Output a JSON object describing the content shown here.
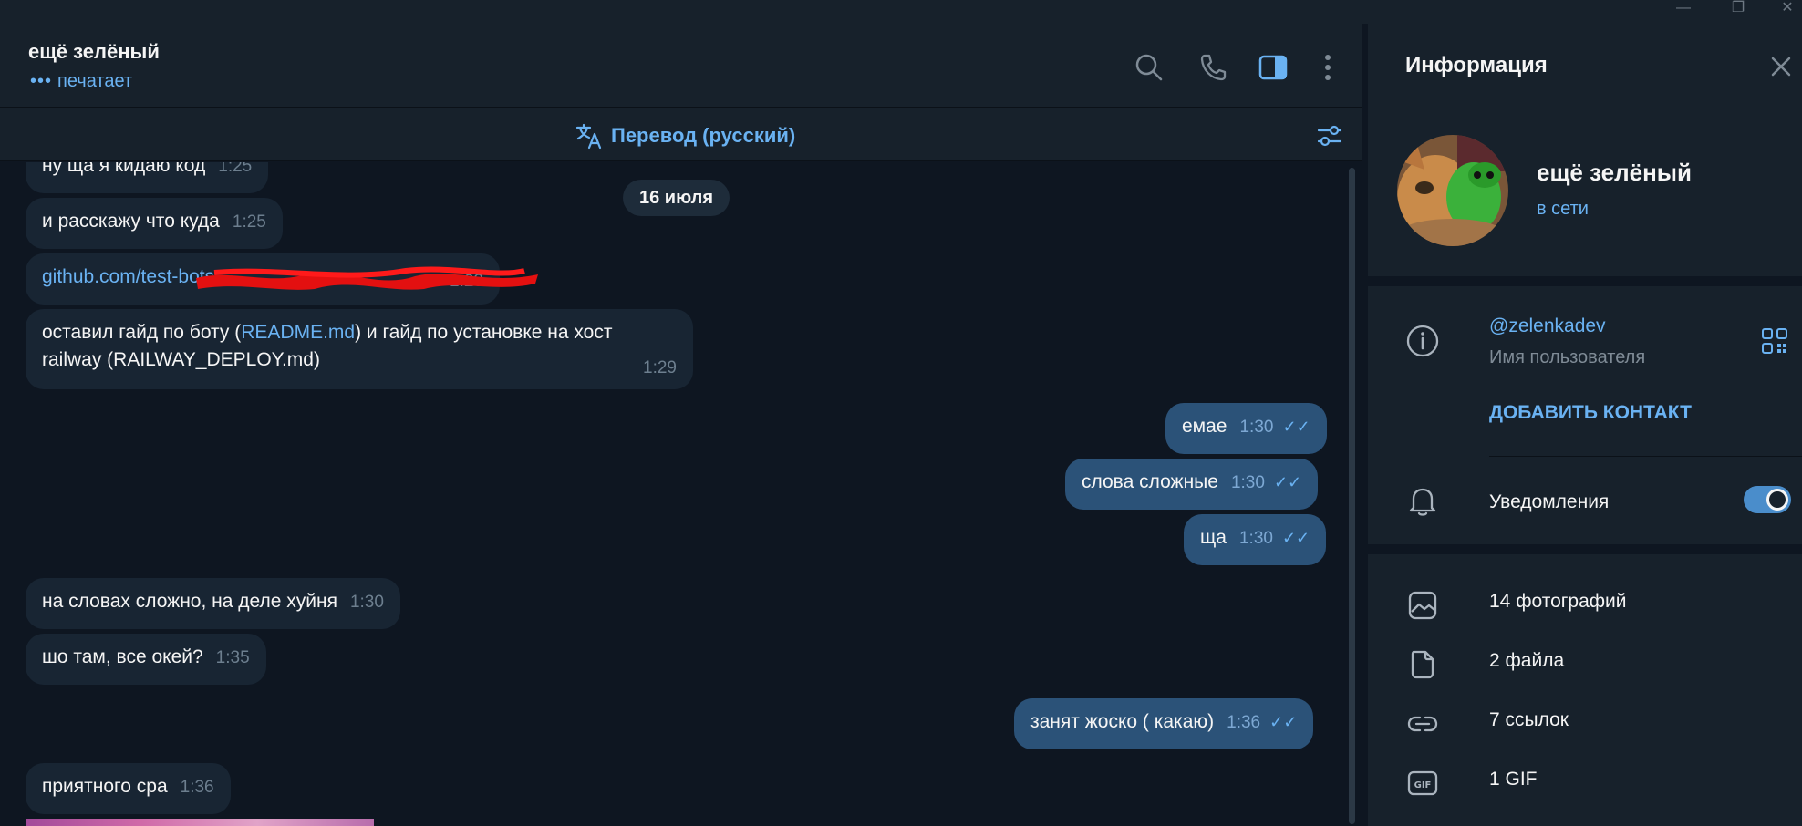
{
  "window": {
    "minimize": "—",
    "restore": "❐",
    "close": "✕"
  },
  "header": {
    "peer_name": "ещё зелёный",
    "status_dots": "•••",
    "status": "печатает"
  },
  "translate": {
    "label": "Перевод (русский)"
  },
  "date_separator": "16 июля",
  "messages": [
    {
      "dir": "in",
      "text": "ну ща я кидаю код",
      "time": "1:25"
    },
    {
      "dir": "in",
      "text": "и расскажу что куда",
      "time": "1:25"
    },
    {
      "dir": "in",
      "link": "github.com/test-bots",
      "time": "1:28"
    },
    {
      "dir": "in",
      "text_before": "оставил гайд по боту (",
      "link": "README.md",
      "text_after": ") и гайд по установке на хост",
      "text_line2": "railway (RAILWAY_DEPLOY.md)",
      "time": "1:29"
    },
    {
      "dir": "out",
      "text": "емае",
      "time": "1:30"
    },
    {
      "dir": "out",
      "text": "слова сложные",
      "time": "1:30"
    },
    {
      "dir": "out",
      "text": "ща",
      "time": "1:30"
    },
    {
      "dir": "in",
      "text": "на словах сложно, на деле хуйня",
      "time": "1:30"
    },
    {
      "dir": "in",
      "text": "шо там, все окей?",
      "time": "1:35"
    },
    {
      "dir": "out",
      "text": "занят жоско ( какаю)",
      "time": "1:36"
    },
    {
      "dir": "in",
      "text": "приятного сра",
      "time": "1:36"
    }
  ],
  "read_ticks": "✓✓",
  "info": {
    "title": "Информация",
    "name": "ещё зелёный",
    "online": "в сети",
    "username": "@zelenkadev",
    "username_label": "Имя пользователя",
    "add_contact": "ДОБАВИТЬ КОНТАКТ",
    "notifications": "Уведомления",
    "notifications_on": true,
    "media": {
      "photos": "14 фотографий",
      "files": "2 файла",
      "links": "7 ссылок",
      "gifs": "1 GIF"
    }
  },
  "colors": {
    "bg": "#0e1621",
    "panel": "#17212b",
    "incoming": "#182533",
    "outgoing": "#2b5278",
    "accent": "#6ab2f2"
  }
}
